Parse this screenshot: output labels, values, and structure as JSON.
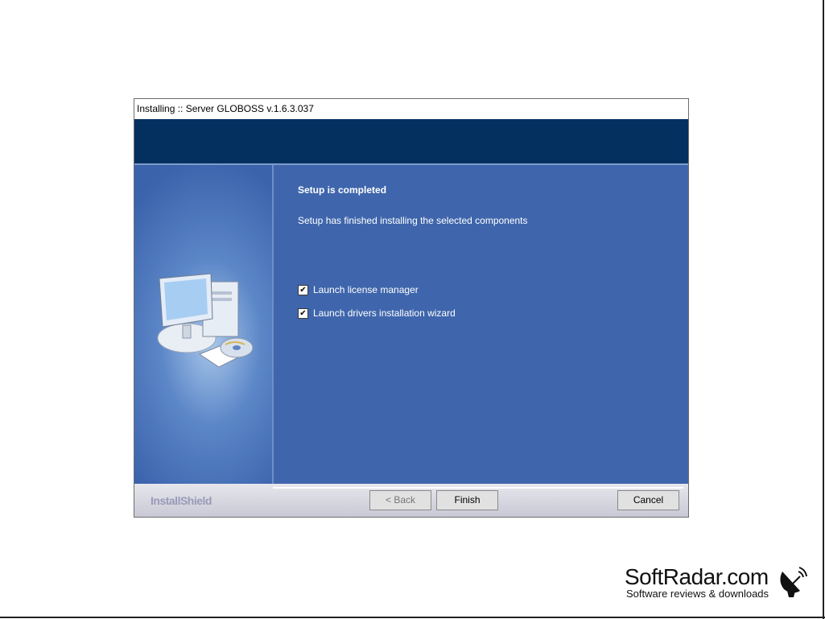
{
  "window": {
    "title": "Installing :: Server GLOBOSS v.1.6.3.037"
  },
  "main": {
    "heading": "Setup is completed",
    "description": "Setup has finished installing the selected components",
    "options": [
      {
        "label": "Launch license manager",
        "checked": true
      },
      {
        "label": "Launch drivers installation wizard",
        "checked": true
      }
    ]
  },
  "footer": {
    "brand": "InstallShield",
    "back_label": "< Back",
    "finish_label": "Finish",
    "cancel_label": "Cancel"
  },
  "watermark": {
    "site": "SoftRadar.com",
    "tagline": "Software reviews & downloads"
  },
  "icons": {
    "setup_illustration": "computer-with-cd-icon",
    "watermark_icon": "satellite-dish-icon",
    "check_glyph": "✔"
  },
  "colors": {
    "header_band": "#043060",
    "panel_blue": "#3f66ac"
  }
}
